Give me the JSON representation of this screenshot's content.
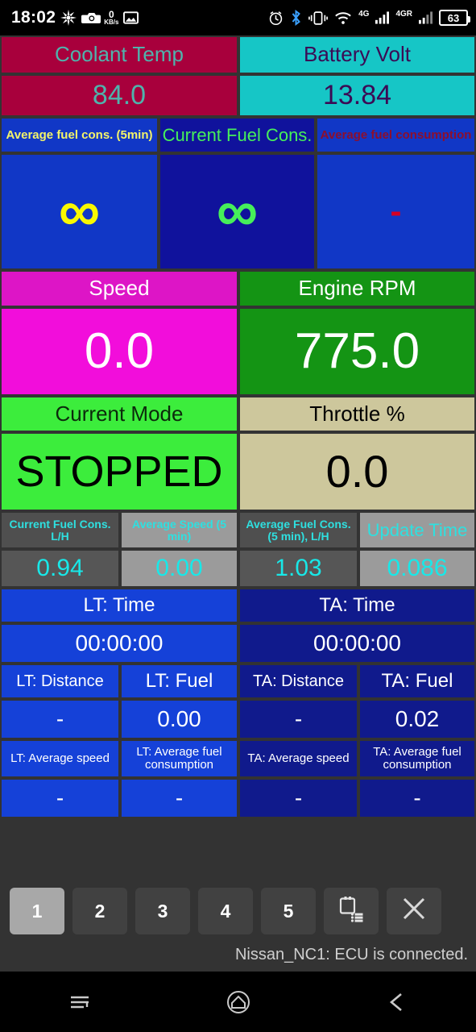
{
  "status_bar": {
    "time": "18:02",
    "net_speed_value": "0",
    "net_speed_unit": "KB/s",
    "battery_percent": "63",
    "network_label_1": "4G",
    "network_label_2": "4GR",
    "icons": [
      "flash-icon",
      "camera-icon",
      "image-icon",
      "alarm-icon",
      "bluetooth-icon",
      "vibrate-icon",
      "wifi-icon",
      "signal-icon",
      "battery-icon"
    ]
  },
  "gauges": {
    "coolant": {
      "label": "Coolant Temp",
      "value": "84.0"
    },
    "battery_volt": {
      "label": "Battery Volt",
      "value": "13.84"
    },
    "avg_fuel_5min": {
      "label": "Average fuel cons. (5min)",
      "value": "∞"
    },
    "current_fuel_cons": {
      "label": "Current Fuel Cons.",
      "value": "∞"
    },
    "avg_fuel_cons": {
      "label": "Average fuel consumption",
      "value": "-"
    },
    "speed": {
      "label": "Speed",
      "value": "0.0"
    },
    "engine_rpm": {
      "label": "Engine RPM",
      "value": "775.0"
    },
    "current_mode": {
      "label": "Current Mode",
      "value": "STOPPED"
    },
    "throttle": {
      "label": "Throttle %",
      "value": "0.0"
    }
  },
  "grey_row": [
    {
      "label": "Current Fuel Cons. L/H",
      "value": "0.94"
    },
    {
      "label": "Average Speed (5 min)",
      "value": "0.00"
    },
    {
      "label": "Average Fuel Cons. (5 min), L/H",
      "value": "1.03"
    },
    {
      "label": "Update Time",
      "value": "0.086"
    }
  ],
  "trip": {
    "lt_time": {
      "label": "LT: Time",
      "value": "00:00:00"
    },
    "ta_time": {
      "label": "TA: Time",
      "value": "00:00:00"
    },
    "lt_distance": {
      "label": "LT: Distance",
      "value": "-"
    },
    "lt_fuel": {
      "label": "LT: Fuel",
      "value": "0.00"
    },
    "ta_distance": {
      "label": "TA: Distance",
      "value": "-"
    },
    "ta_fuel": {
      "label": "TA: Fuel",
      "value": "0.02"
    },
    "lt_avg_speed": {
      "label": "LT: Average speed",
      "value": "-"
    },
    "lt_avg_fuel": {
      "label": "LT: Average fuel consumption",
      "value": "-"
    },
    "ta_avg_speed": {
      "label": "TA: Average speed",
      "value": "-"
    },
    "ta_avg_fuel": {
      "label": "TA: Average fuel consumption",
      "value": "-"
    }
  },
  "toolbar": {
    "buttons": [
      "1",
      "2",
      "3",
      "4",
      "5"
    ],
    "active_button": "1",
    "log_icon": "clipboard-list-icon",
    "close_icon": "close-icon",
    "status_text": "Nissan_NC1: ECU is connected."
  },
  "navigation": {
    "recent": "recent-apps-icon",
    "home": "home-icon",
    "back": "back-icon"
  },
  "colors": {
    "coolant_bg": "#a8003c",
    "battery_bg": "#16c6c6",
    "fuel_blue": "#1137c6",
    "fuel_navy": "#10129c",
    "speed_bg": "#f20ddb",
    "rpm_bg": "#149414",
    "mode_bg": "#3ced3c",
    "throttle_bg": "#cdc79c",
    "lt_blue": "#1541d8",
    "ta_navy": "#101a8c",
    "cyan_text": "#18e8e8"
  }
}
